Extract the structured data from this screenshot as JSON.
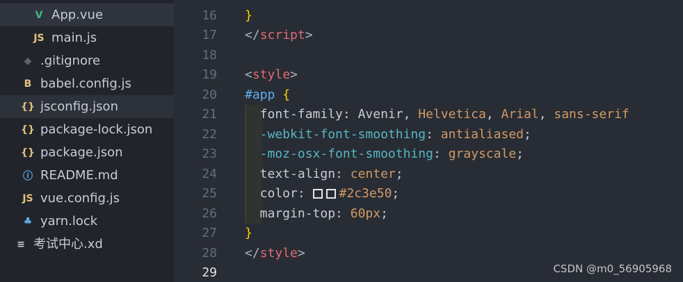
{
  "sidebar": {
    "files": [
      {
        "name": "App.vue",
        "icon": "V",
        "icon_name": "vue-icon",
        "icon_color": "#42b883"
      },
      {
        "name": "main.js",
        "icon": "JS",
        "icon_name": "javascript-icon",
        "icon_color": "#e5c07b"
      },
      {
        "name": ".gitignore",
        "icon": "◆",
        "icon_name": "git-icon",
        "icon_color": "#5c6370"
      },
      {
        "name": "babel.config.js",
        "icon": "B",
        "icon_name": "babel-icon",
        "icon_color": "#e5c07b"
      },
      {
        "name": "jsconfig.json",
        "icon": "{}",
        "icon_name": "json-icon",
        "icon_color": "#e5c07b"
      },
      {
        "name": "package-lock.json",
        "icon": "{}",
        "icon_name": "json-icon",
        "icon_color": "#e5c07b"
      },
      {
        "name": "package.json",
        "icon": "{}",
        "icon_name": "json-icon",
        "icon_color": "#e5c07b"
      },
      {
        "name": "README.md",
        "icon": "ⓘ",
        "icon_name": "info-icon",
        "icon_color": "#61afef"
      },
      {
        "name": "vue.config.js",
        "icon": "JS",
        "icon_name": "javascript-icon",
        "icon_color": "#e5c07b"
      },
      {
        "name": "yarn.lock",
        "icon": "♣",
        "icon_name": "yarn-icon",
        "icon_color": "#61afef"
      },
      {
        "name": "考试中心.xd",
        "icon": "≡",
        "icon_name": "file-lines-icon",
        "icon_color": "#c8ccd4"
      }
    ]
  },
  "editor": {
    "line_numbers": [
      "16",
      "17",
      "18",
      "19",
      "20",
      "21",
      "22",
      "23",
      "24",
      "25",
      "26",
      "27",
      "28",
      "29"
    ],
    "current_line": "29",
    "lines": [
      [
        {
          "t": "}",
          "c": "t-brace"
        }
      ],
      [
        {
          "t": "</",
          "c": "t-punc"
        },
        {
          "t": "script",
          "c": "t-tag"
        },
        {
          "t": ">",
          "c": "t-punc"
        }
      ],
      [],
      [
        {
          "t": "<",
          "c": "t-punc"
        },
        {
          "t": "style",
          "c": "t-tag"
        },
        {
          "t": ">",
          "c": "t-punc"
        }
      ],
      [
        {
          "t": "#app",
          "c": "t-sel"
        },
        {
          "t": " ",
          "c": "t-plain"
        },
        {
          "t": "{",
          "c": "t-brace"
        }
      ],
      [
        {
          "t": "  font-family",
          "c": "t-prop"
        },
        {
          "t": ": Avenir, ",
          "c": "t-plain"
        },
        {
          "t": "Helvetica",
          "c": "t-val"
        },
        {
          "t": ", ",
          "c": "t-plain"
        },
        {
          "t": "Arial",
          "c": "t-val"
        },
        {
          "t": ", ",
          "c": "t-plain"
        },
        {
          "t": "sans-serif",
          "c": "t-val"
        }
      ],
      [
        {
          "t": "  -webkit-font-smoothing",
          "c": "t-vendor"
        },
        {
          "t": ": ",
          "c": "t-plain"
        },
        {
          "t": "antialiased",
          "c": "t-val"
        },
        {
          "t": ";",
          "c": "t-plain"
        }
      ],
      [
        {
          "t": "  -moz-osx-font-smoothing",
          "c": "t-vendor"
        },
        {
          "t": ": ",
          "c": "t-plain"
        },
        {
          "t": "grayscale",
          "c": "t-val"
        },
        {
          "t": ";",
          "c": "t-plain"
        }
      ],
      [
        {
          "t": "  text-align",
          "c": "t-prop"
        },
        {
          "t": ": ",
          "c": "t-plain"
        },
        {
          "t": "center",
          "c": "t-val"
        },
        {
          "t": ";",
          "c": "t-plain"
        }
      ],
      [
        {
          "t": "  color",
          "c": "t-prop"
        },
        {
          "t": ": ",
          "c": "t-plain"
        },
        {
          "t": "",
          "c": "swatch"
        },
        {
          "t": "",
          "c": "swatch"
        },
        {
          "t": "#2c3e50",
          "c": "t-val"
        },
        {
          "t": ";",
          "c": "t-plain"
        }
      ],
      [
        {
          "t": "  margin-top",
          "c": "t-prop"
        },
        {
          "t": ": ",
          "c": "t-plain"
        },
        {
          "t": "60px",
          "c": "t-num"
        },
        {
          "t": ";",
          "c": "t-plain"
        }
      ],
      [
        {
          "t": "}",
          "c": "t-brace"
        }
      ],
      [
        {
          "t": "</",
          "c": "t-punc"
        },
        {
          "t": "style",
          "c": "t-tag"
        },
        {
          "t": ">",
          "c": "t-punc"
        }
      ],
      []
    ]
  },
  "watermark": "CSDN @m0_56905968",
  "colors": {
    "sidebar_bg": "#21252b",
    "editor_bg": "#282c34",
    "tag": "#e06c75",
    "selector": "#61afef",
    "value": "#d19a66",
    "vendor_prop": "#56b6c2",
    "brace": "#ffd700"
  }
}
